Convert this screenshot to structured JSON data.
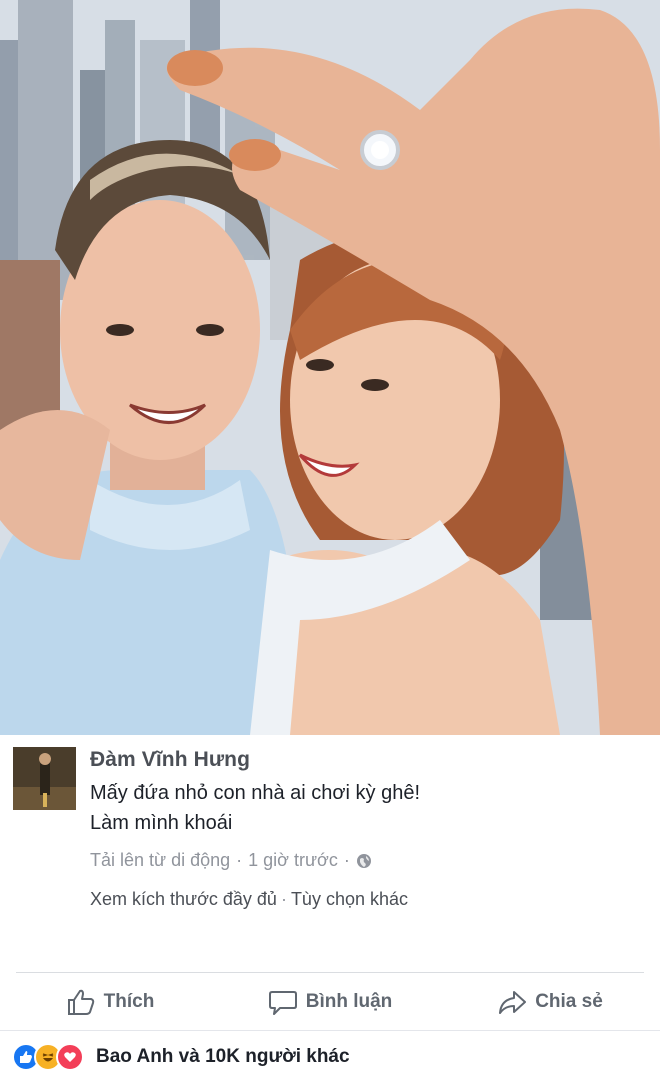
{
  "post": {
    "author": "Đàm Vĩnh Hưng",
    "caption_line1": "Mấy đứa nhỏ con nhà ai chơi kỳ ghê!",
    "caption_line2": "Làm mình khoái",
    "upload_source": "Tải lên từ di động",
    "separator": "·",
    "time": "1 giờ trước",
    "audience_icon": "globe-icon",
    "view_full_size": "Xem kích thước đầy đủ",
    "more_options": "Tùy chọn khác"
  },
  "actions": {
    "like_label": "Thích",
    "comment_label": "Bình luận",
    "share_label": "Chia sẻ"
  },
  "reactions": {
    "icons": [
      "like-icon",
      "haha-icon",
      "love-icon"
    ],
    "summary": "Bao Anh và 10K người khác"
  },
  "colors": {
    "facebook_blue": "#1877f2",
    "love_red": "#f33e58",
    "haha_yellow": "#f7b125",
    "meta_gray": "#90949c"
  }
}
